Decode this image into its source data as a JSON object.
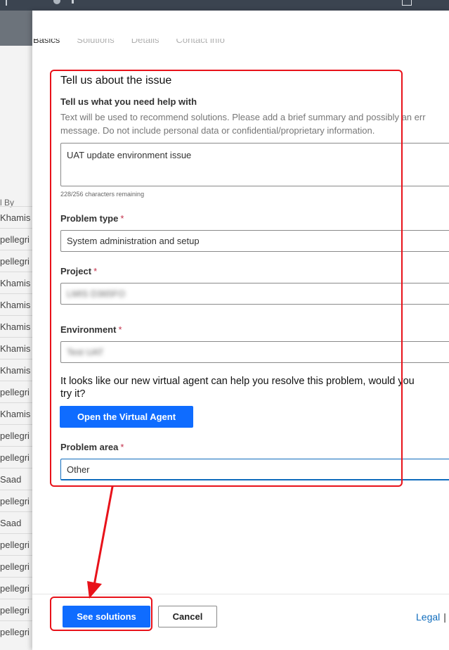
{
  "background_table": {
    "header": "l By",
    "rows": [
      "Khamis",
      "pellegri",
      "pellegri",
      "Khamis",
      "Khamis",
      "Khamis",
      "Khamis",
      "Khamis",
      "pellegri",
      "Khamis",
      "pellegri",
      "pellegri",
      "Saad",
      "pellegri",
      "Saad",
      "pellegri",
      "pellegri",
      "pellegri",
      "pellegri",
      "pellegri"
    ]
  },
  "tabs": [
    "Basics",
    "Solutions",
    "Details",
    "Contact info"
  ],
  "section_title": "Tell us about the issue",
  "summary": {
    "label": "Tell us what you need help with",
    "help_line1": "Text will be used to recommend solutions. Please add a brief summary and possibly an err",
    "help_line2": "message. Do not include personal data or confidential/proprietary information.",
    "value": "UAT update environment issue",
    "counter": "228/256 characters remaining"
  },
  "problem_type": {
    "label": "Problem type",
    "required": "*",
    "value": "System administration and setup"
  },
  "project": {
    "label": "Project",
    "required": "*",
    "value": "LMIS D365FO"
  },
  "environment": {
    "label": "Environment",
    "required": "*",
    "value": "Test UAT"
  },
  "virtual_agent": {
    "line1": "It looks like our new virtual agent can help you resolve this problem, would you",
    "line2": "try it?",
    "button": "Open the Virtual Agent"
  },
  "problem_area": {
    "label": "Problem area",
    "required": "*",
    "value": "Other"
  },
  "footer": {
    "see_solutions": "See solutions",
    "cancel": "Cancel",
    "legal": "Legal",
    "separator": "|"
  },
  "colors": {
    "primary": "#0f6cff",
    "annotation": "#e8121a",
    "required": "#c4314b"
  }
}
